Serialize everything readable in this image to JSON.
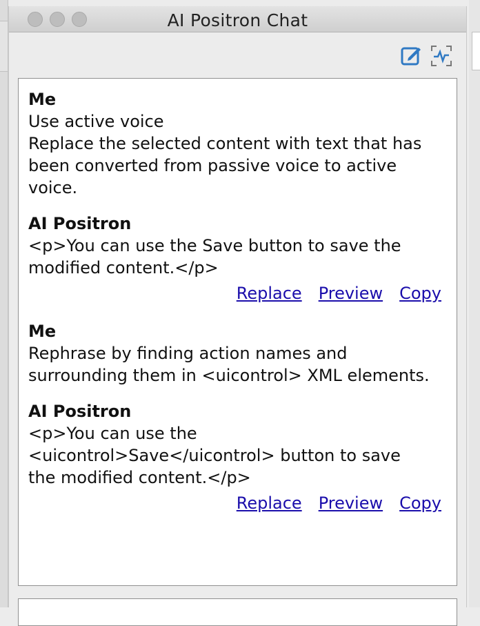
{
  "window": {
    "title": "AI Positron Chat"
  },
  "toolbar": {
    "new_chat_icon": "edit-square-icon",
    "activity_icon": "activity-icon"
  },
  "colors": {
    "link": "#1a0dab",
    "toolbar_icon": "#2f79c3"
  },
  "messages": [
    {
      "sender": "Me",
      "lines": [
        "Use active voice",
        "Replace the selected content with text that has",
        "been converted from passive voice to active",
        "voice."
      ]
    },
    {
      "sender": "AI Positron",
      "lines": [
        "<p>You can use the Save button to save the",
        "modified content.</p>"
      ],
      "actions": [
        "Replace",
        "Preview",
        "Copy"
      ]
    },
    {
      "sender": "Me",
      "lines": [
        "Rephrase by finding action names and",
        "surrounding them in <uicontrol> XML elements."
      ]
    },
    {
      "sender": "AI Positron",
      "lines": [
        "<p>You can use the",
        "<uicontrol>Save</uicontrol> button to save",
        "the modified content.</p>"
      ],
      "actions": [
        "Replace",
        "Preview",
        "Copy"
      ]
    }
  ]
}
